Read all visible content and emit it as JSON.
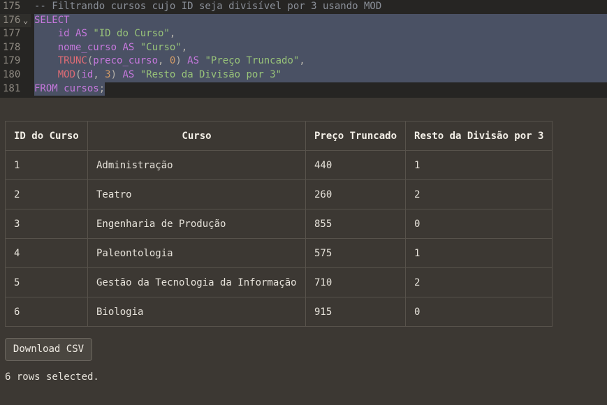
{
  "editor": {
    "lines": [
      {
        "num": "175",
        "tokens": [
          {
            "t": "-- Filtrando cursos cujo ID seja divisível por 3 usando MOD",
            "c": "c"
          }
        ]
      },
      {
        "num": "176",
        "fold": "⌄",
        "tokens": [
          {
            "t": "SELECT",
            "c": "k"
          }
        ]
      },
      {
        "num": "177",
        "tokens": [
          {
            "t": "    id ",
            "c": "id"
          },
          {
            "t": "AS",
            "c": "k"
          },
          {
            "t": " ",
            "c": "p"
          },
          {
            "t": "\"ID do Curso\"",
            "c": "s"
          },
          {
            "t": ",",
            "c": "p"
          }
        ]
      },
      {
        "num": "178",
        "tokens": [
          {
            "t": "    nome_curso ",
            "c": "id"
          },
          {
            "t": "AS",
            "c": "k"
          },
          {
            "t": " ",
            "c": "p"
          },
          {
            "t": "\"Curso\"",
            "c": "s"
          },
          {
            "t": ",",
            "c": "p"
          }
        ]
      },
      {
        "num": "179",
        "tokens": [
          {
            "t": "    TRUNC",
            "c": "f"
          },
          {
            "t": "(",
            "c": "p"
          },
          {
            "t": "preco_curso",
            "c": "id"
          },
          {
            "t": ", ",
            "c": "p"
          },
          {
            "t": "0",
            "c": "n"
          },
          {
            "t": ") ",
            "c": "p"
          },
          {
            "t": "AS",
            "c": "k"
          },
          {
            "t": " ",
            "c": "p"
          },
          {
            "t": "\"Preço Truncado\"",
            "c": "s"
          },
          {
            "t": ",",
            "c": "p"
          }
        ]
      },
      {
        "num": "180",
        "tokens": [
          {
            "t": "    MOD",
            "c": "f"
          },
          {
            "t": "(",
            "c": "p"
          },
          {
            "t": "id",
            "c": "id"
          },
          {
            "t": ", ",
            "c": "p"
          },
          {
            "t": "3",
            "c": "n"
          },
          {
            "t": ") ",
            "c": "p"
          },
          {
            "t": "AS",
            "c": "k"
          },
          {
            "t": " ",
            "c": "p"
          },
          {
            "t": "\"Resto da Divisão por 3\"",
            "c": "s"
          }
        ]
      },
      {
        "num": "181",
        "tokens": [
          {
            "t": "FROM",
            "c": "k"
          },
          {
            "t": " ",
            "c": "p"
          },
          {
            "t": "cursos",
            "c": "id"
          },
          {
            "t": ";",
            "c": "p"
          }
        ]
      }
    ]
  },
  "table": {
    "headers": [
      "ID do Curso",
      "Curso",
      "Preço Truncado",
      "Resto da Divisão por 3"
    ],
    "rows": [
      [
        "1",
        "Administração",
        "440",
        "1"
      ],
      [
        "2",
        "Teatro",
        "260",
        "2"
      ],
      [
        "3",
        "Engenharia de Produção",
        "855",
        "0"
      ],
      [
        "4",
        "Paleontologia",
        "575",
        "1"
      ],
      [
        "5",
        "Gestão da Tecnologia da Informação",
        "710",
        "2"
      ],
      [
        "6",
        "Biologia",
        "915",
        "0"
      ]
    ]
  },
  "download_label": "Download CSV",
  "status_text": "6 rows selected."
}
